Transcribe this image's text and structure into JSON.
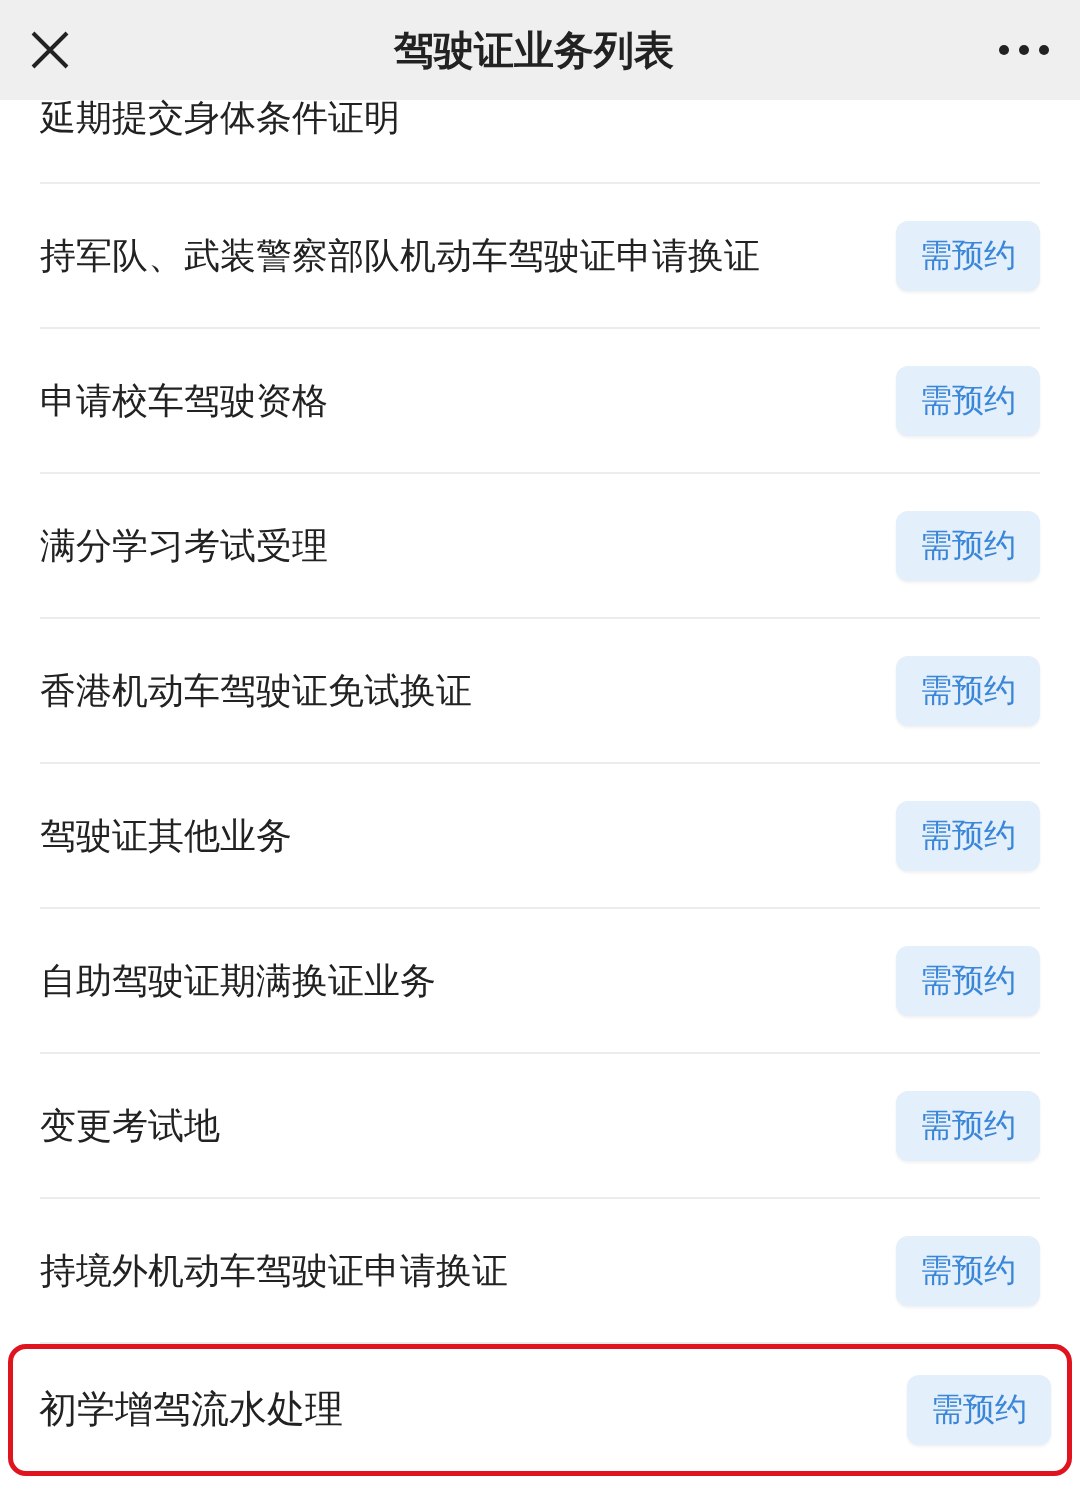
{
  "header": {
    "title": "驾驶证业务列表"
  },
  "items": [
    {
      "label": "延期提交身体条件证明",
      "highlighted": false,
      "partial": true
    },
    {
      "label": "持军队、武装警察部队机动车驾驶证申请换证",
      "badge": "需预约",
      "highlighted": false
    },
    {
      "label": "申请校车驾驶资格",
      "badge": "需预约",
      "highlighted": false
    },
    {
      "label": "满分学习考试受理",
      "badge": "需预约",
      "highlighted": false
    },
    {
      "label": "香港机动车驾驶证免试换证",
      "badge": "需预约",
      "highlighted": false
    },
    {
      "label": "驾驶证其他业务",
      "badge": "需预约",
      "highlighted": false
    },
    {
      "label": "自助驾驶证期满换证业务",
      "badge": "需预约",
      "highlighted": false
    },
    {
      "label": "变更考试地",
      "badge": "需预约",
      "highlighted": false
    },
    {
      "label": "持境外机动车驾驶证申请换证",
      "badge": "需预约",
      "highlighted": false
    },
    {
      "label": "初学增驾流水处理",
      "badge": "需预约",
      "highlighted": true
    }
  ]
}
